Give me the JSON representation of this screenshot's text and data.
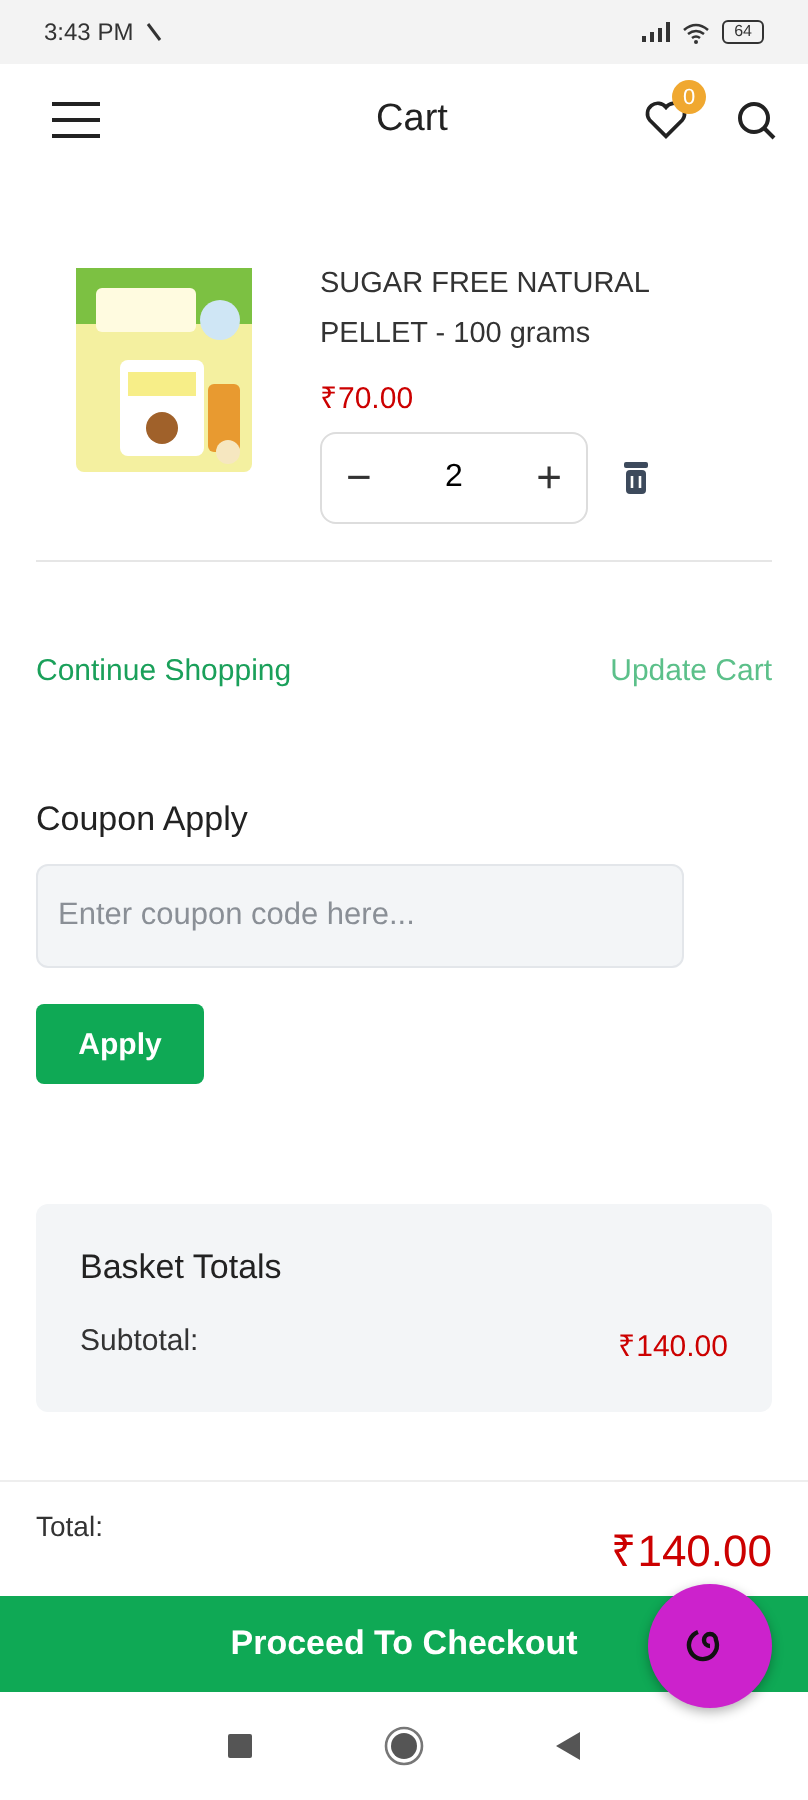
{
  "status_bar": {
    "time": "3:43 PM",
    "battery": "64"
  },
  "header": {
    "title": "Cart",
    "wishlist_count": "0"
  },
  "cart_items": [
    {
      "name": "SUGAR FREE NATURAL PELLET - 100 grams",
      "price": "₹70.00",
      "quantity": "2",
      "decrement": "−",
      "increment": "+"
    }
  ],
  "links": {
    "continue": "Continue Shopping",
    "update": "Update Cart"
  },
  "coupon": {
    "title": "Coupon Apply",
    "placeholder": "Enter coupon code here...",
    "button": "Apply"
  },
  "basket_totals": {
    "title": "Basket Totals",
    "subtotal_label": "Subtotal:",
    "subtotal": "₹140.00"
  },
  "footer": {
    "total_label": "Total:",
    "total": "₹140.00",
    "checkout": "Proceed To Checkout"
  }
}
